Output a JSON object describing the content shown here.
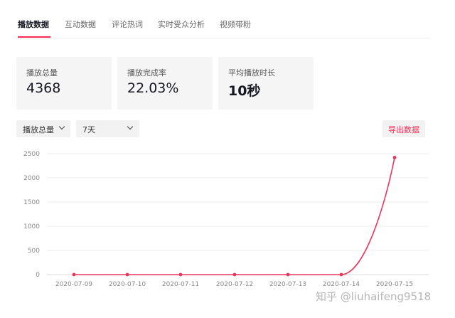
{
  "tabs": [
    {
      "label": "播放数据",
      "active": true
    },
    {
      "label": "互动数据",
      "active": false
    },
    {
      "label": "评论热词",
      "active": false
    },
    {
      "label": "实时受众分析",
      "active": false
    },
    {
      "label": "视频带粉",
      "active": false
    }
  ],
  "stats": [
    {
      "label": "播放总量",
      "value": "4368"
    },
    {
      "label": "播放完成率",
      "value": "22.03%"
    },
    {
      "label": "平均播放时长",
      "value": "10秒"
    }
  ],
  "controls": {
    "metric_select": "播放总量",
    "range_select": "7天",
    "export_label": "导出数据"
  },
  "chart_data": {
    "type": "line",
    "x": [
      "2020-07-09",
      "2020-07-10",
      "2020-07-11",
      "2020-07-12",
      "2020-07-13",
      "2020-07-14",
      "2020-07-15"
    ],
    "series": [
      {
        "values": [
          0,
          0,
          0,
          0,
          0,
          0,
          2420
        ]
      }
    ],
    "ylim": [
      0,
      2500
    ],
    "yticks": [
      0,
      500,
      1000,
      1500,
      2000,
      2500
    ],
    "grid": true,
    "line_color": "#e8365d"
  },
  "watermark": "知乎 @liuhaifeng9518"
}
